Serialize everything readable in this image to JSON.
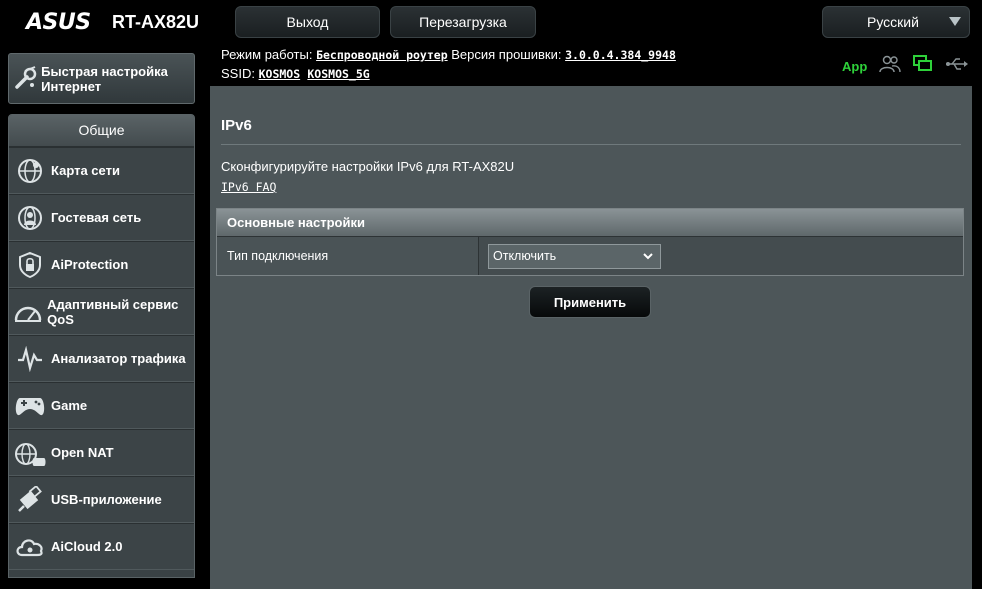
{
  "header": {
    "brand": "ASUS",
    "model": "RT-AX82U",
    "logout_label": "Выход",
    "reboot_label": "Перезагрузка",
    "language": "Русский"
  },
  "status": {
    "mode_label": "Режим работы:",
    "mode_value": "Беспроводной роутер",
    "firmware_label": "Версия прошивки:",
    "firmware_value": "3.0.0.4.384_9948",
    "ssid_label": "SSID:",
    "ssid_1": "KOSMOS",
    "ssid_2": "KOSMOS_5G",
    "app_label": "App",
    "icons": [
      "app-icon",
      "clients-icon",
      "network-status-icon",
      "usb-icon"
    ],
    "accent": "#2ed13a"
  },
  "sidebar": {
    "quick_setup": "Быстрая настройка Интернет",
    "section_title": "Общие",
    "items": [
      {
        "label": "Карта сети",
        "icon": "network-map-icon"
      },
      {
        "label": "Гостевая сеть",
        "icon": "guest-network-icon"
      },
      {
        "label": "AiProtection",
        "icon": "shield-icon"
      },
      {
        "label": "Адаптивный сервис QoS",
        "icon": "qos-gauge-icon"
      },
      {
        "label": "Анализатор трафика",
        "icon": "traffic-analyzer-icon"
      },
      {
        "label": "Game",
        "icon": "gamepad-icon"
      },
      {
        "label": "Open NAT",
        "icon": "open-nat-icon"
      },
      {
        "label": "USB-приложение",
        "icon": "usb-app-icon"
      },
      {
        "label": "AiCloud 2.0",
        "icon": "aicloud-icon"
      }
    ]
  },
  "main": {
    "title": "IPv6",
    "description": "Сконфигурируйте настройки IPv6 для RT-AX82U",
    "faq_link": "IPv6 FAQ",
    "section_header": "Основные настройки",
    "connection_type_label": "Тип подключения",
    "connection_type_value": "Отключить",
    "apply_label": "Применить"
  },
  "colors": {
    "background": "#000000",
    "panel": "#4d5659",
    "sidebar": "#3c4447"
  }
}
